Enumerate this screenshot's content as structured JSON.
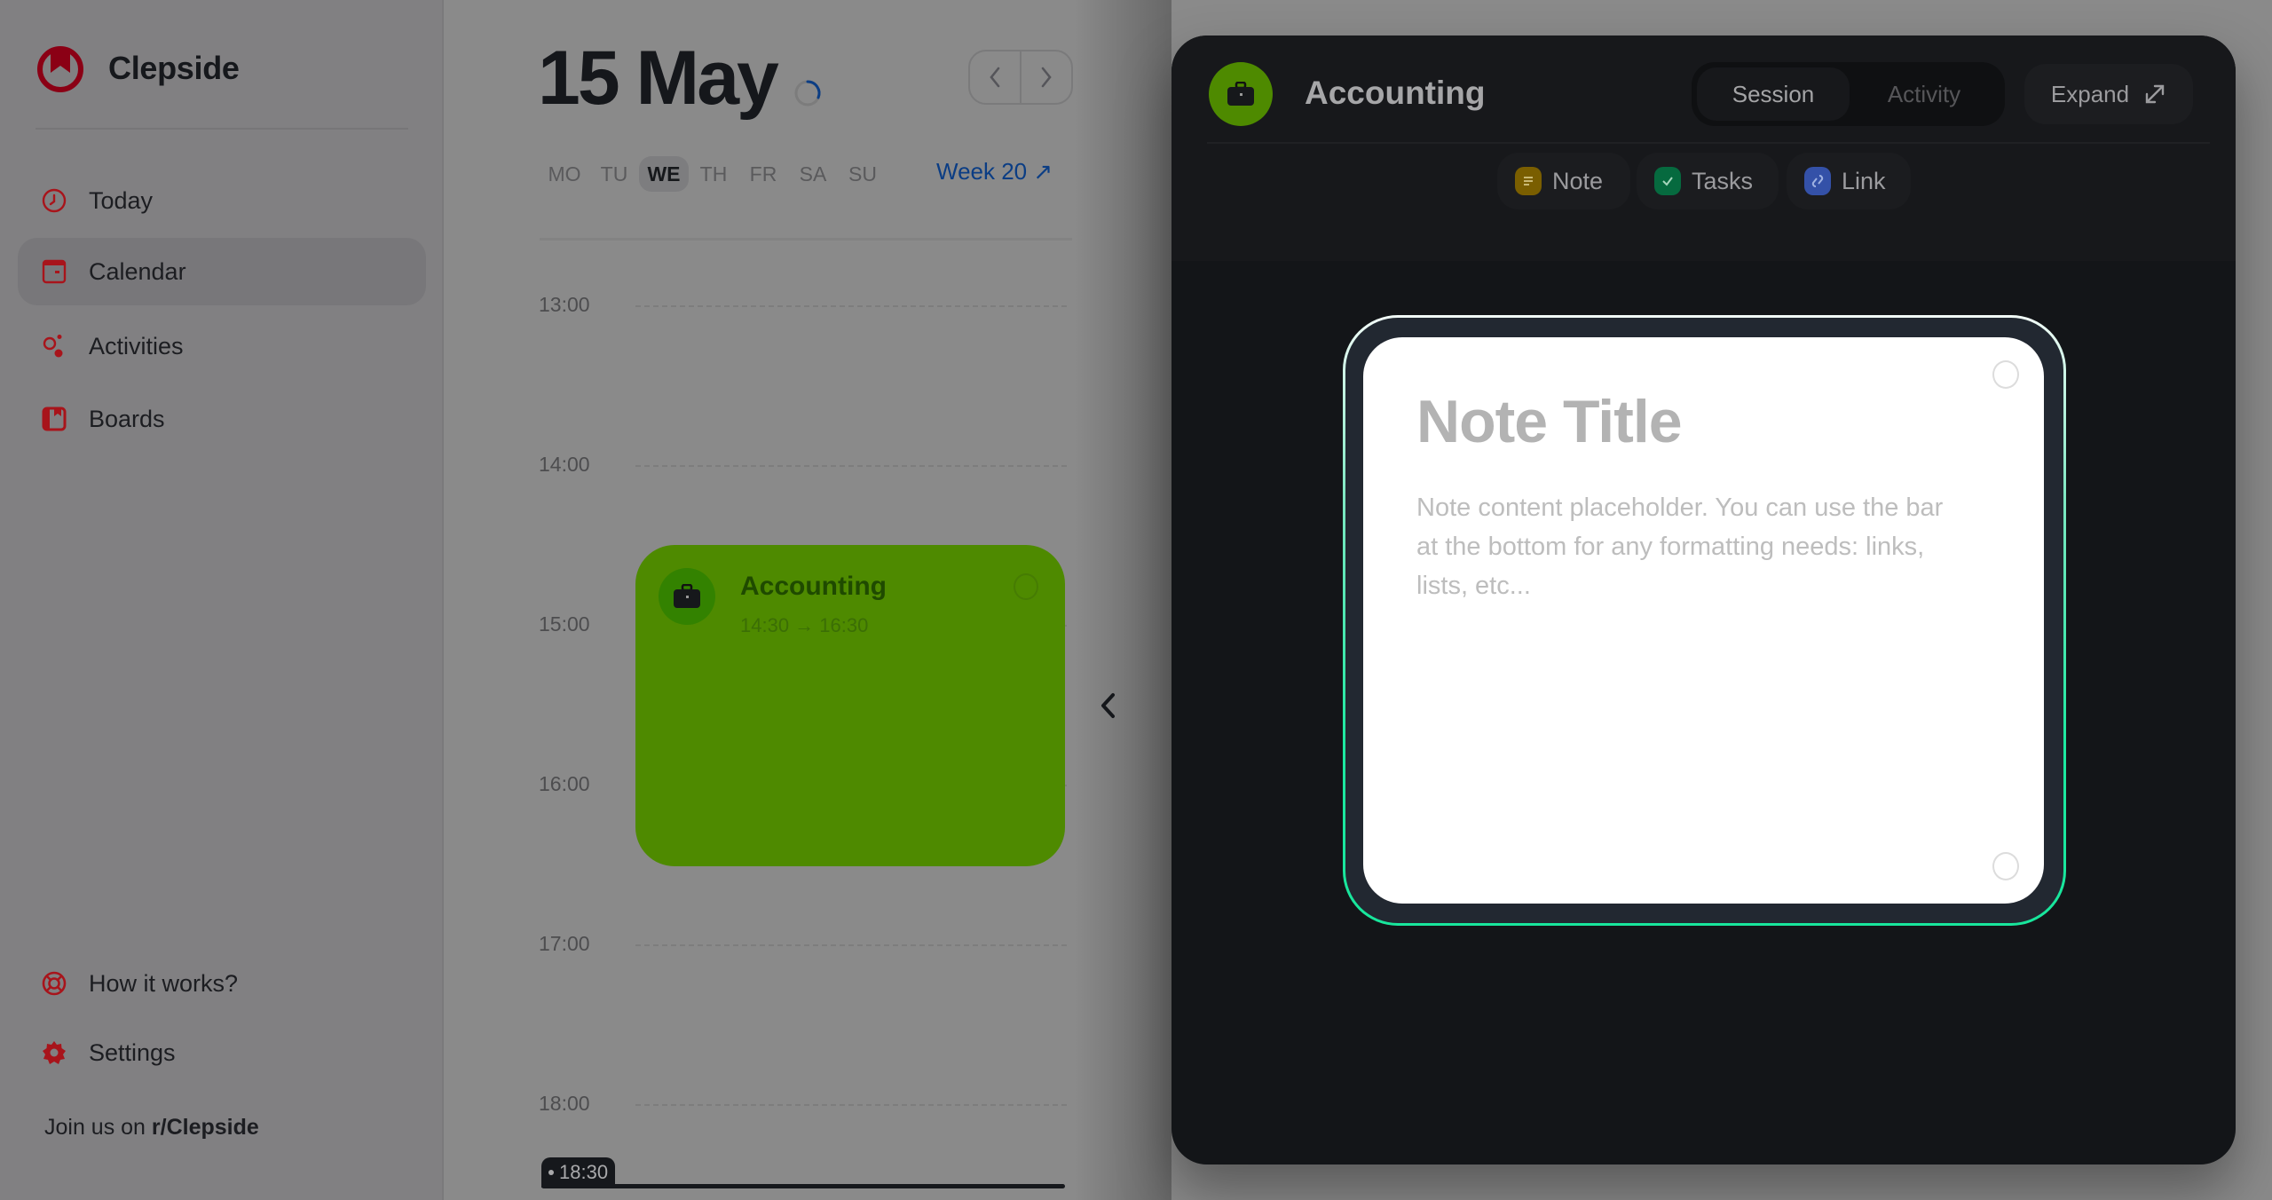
{
  "app": {
    "name": "Clepside",
    "brand_color": "#8b0015"
  },
  "sidebar": {
    "items": [
      {
        "label": "Today",
        "icon": "clock-icon"
      },
      {
        "label": "Calendar",
        "icon": "calendar-icon",
        "active": true
      },
      {
        "label": "Activities",
        "icon": "activities-icon"
      },
      {
        "label": "Boards",
        "icon": "boards-icon"
      }
    ],
    "footer_items": [
      {
        "label": "How it works?",
        "icon": "lifebuoy-icon"
      },
      {
        "label": "Settings",
        "icon": "gear-icon"
      }
    ],
    "join_prefix": "Join us on ",
    "join_link": "r/Clepside"
  },
  "calendar": {
    "title": "15 May",
    "days": [
      "MO",
      "TU",
      "WE",
      "TH",
      "FR",
      "SA",
      "SU"
    ],
    "active_day": "WE",
    "week_label": "Week 20 ↗",
    "hours": [
      "13:00",
      "14:00",
      "15:00",
      "16:00",
      "17:00",
      "18:00"
    ],
    "now_label": "18:30",
    "event": {
      "title": "Accounting",
      "time": "14:30 → 16:30",
      "icon": "briefcase-icon",
      "color": "#4e8a00"
    }
  },
  "panel": {
    "title": "Accounting",
    "icon": "briefcase-icon",
    "segments": [
      {
        "label": "Session",
        "active": true
      },
      {
        "label": "Activity",
        "active": false
      }
    ],
    "expand_label": "Expand",
    "add_pills": [
      {
        "label": "Note",
        "icon": "note-icon",
        "color": "#7a5e00"
      },
      {
        "label": "Tasks",
        "icon": "check-icon",
        "color": "#066a3f"
      },
      {
        "label": "Link",
        "icon": "link-icon",
        "color": "#3451a8"
      }
    ],
    "note": {
      "title_placeholder": "Note Title",
      "body_placeholder": "Note content placeholder. You can use the bar at the bottom for any formatting needs: links, lists, etc..."
    }
  }
}
